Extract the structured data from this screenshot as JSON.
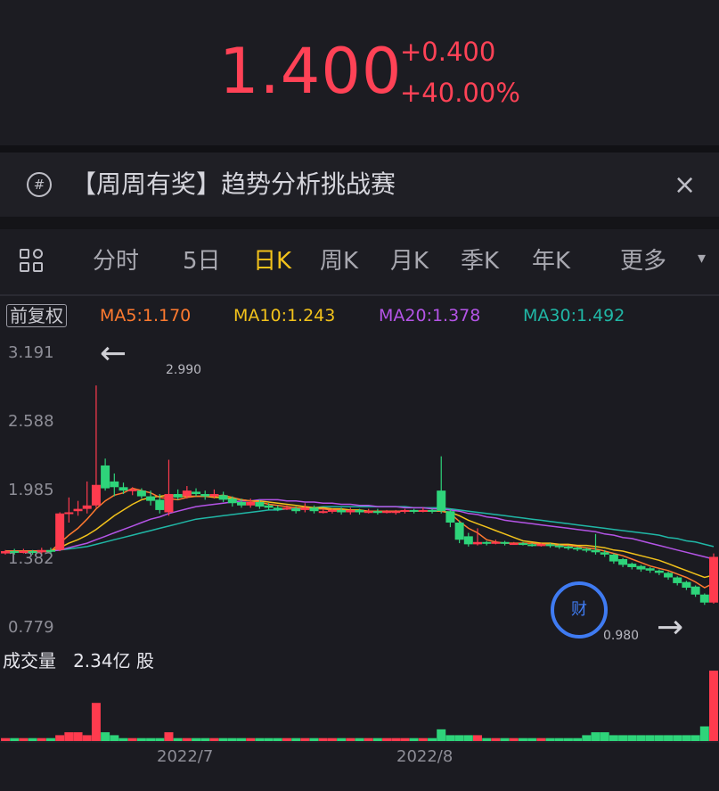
{
  "quote": {
    "price": "1.400",
    "change": "+0.400",
    "change_pct": "+40.00%",
    "color": "#ff4256"
  },
  "banner": {
    "icon": "hash-circle-icon",
    "text": "【周周有奖】趋势分析挑战赛",
    "close": "×"
  },
  "tabs": {
    "items": [
      "分时",
      "5日",
      "日K",
      "周K",
      "月K",
      "季K",
      "年K",
      "更多"
    ],
    "active": "日K",
    "active_color": "#f2c21b",
    "more_arrow": "▾"
  },
  "indicators": {
    "adjust": "前复权",
    "ma5": "MA5:1.170",
    "ma10": "MA10:1.243",
    "ma20": "MA20:1.378",
    "ma30": "MA30:1.492",
    "colors": {
      "ma5": "#ff7a2f",
      "ma10": "#f2c21b",
      "ma20": "#b454e6",
      "ma30": "#20b7a6"
    }
  },
  "chart": {
    "y_ticks": [
      "3.191",
      "2.588",
      "1.985",
      "1.382",
      "0.779"
    ],
    "high_label": "2.990",
    "low_label": "0.980",
    "badge": "财",
    "volume_title": "成交量",
    "volume_value": "2.34亿 股",
    "x_ticks": [
      "2022/7",
      "2022/8"
    ],
    "arrow_left": "←",
    "arrow_right": "→"
  },
  "chart_data": {
    "type": "candlestick",
    "ylim": [
      0.779,
      3.191
    ],
    "up_color": "#ff3b4e",
    "down_color": "#2ed47a",
    "candles": [
      [
        1.43,
        1.45,
        1.42,
        1.46
      ],
      [
        1.45,
        1.44,
        1.42,
        1.47
      ],
      [
        1.44,
        1.45,
        1.43,
        1.47
      ],
      [
        1.45,
        1.44,
        1.42,
        1.46
      ],
      [
        1.44,
        1.46,
        1.43,
        1.48
      ],
      [
        1.46,
        1.45,
        1.43,
        1.48
      ],
      [
        1.46,
        1.78,
        1.45,
        1.79
      ],
      [
        1.79,
        1.79,
        1.7,
        1.92
      ],
      [
        1.8,
        1.82,
        1.76,
        1.89
      ],
      [
        1.82,
        1.85,
        1.78,
        2.06
      ],
      [
        1.85,
        2.03,
        1.83,
        2.9
      ],
      [
        2.2,
        2.0,
        1.98,
        2.26
      ],
      [
        2.06,
        2.01,
        1.93,
        2.13
      ],
      [
        2.01,
        1.98,
        1.95,
        2.05
      ],
      [
        1.99,
        1.99,
        1.94,
        2.01
      ],
      [
        1.98,
        1.93,
        1.91,
        2.0
      ],
      [
        1.93,
        1.89,
        1.85,
        1.98
      ],
      [
        1.9,
        1.81,
        1.78,
        1.95
      ],
      [
        1.79,
        1.95,
        1.76,
        2.25
      ],
      [
        1.95,
        1.92,
        1.9,
        1.99
      ],
      [
        1.93,
        1.98,
        1.91,
        2.02
      ],
      [
        1.97,
        1.95,
        1.93,
        2.0
      ],
      [
        1.95,
        1.93,
        1.9,
        1.98
      ],
      [
        1.93,
        1.95,
        1.91,
        1.99
      ],
      [
        1.94,
        1.9,
        1.88,
        1.97
      ],
      [
        1.91,
        1.87,
        1.84,
        1.93
      ],
      [
        1.88,
        1.85,
        1.83,
        1.91
      ],
      [
        1.85,
        1.88,
        1.83,
        1.91
      ],
      [
        1.88,
        1.84,
        1.82,
        1.9
      ],
      [
        1.85,
        1.83,
        1.81,
        1.87
      ],
      [
        1.83,
        1.82,
        1.8,
        1.85
      ],
      [
        1.83,
        1.83,
        1.81,
        1.85
      ],
      [
        1.82,
        1.8,
        1.78,
        1.84
      ],
      [
        1.81,
        1.83,
        1.79,
        1.87
      ],
      [
        1.83,
        1.8,
        1.78,
        1.85
      ],
      [
        1.8,
        1.8,
        1.78,
        1.82
      ],
      [
        1.8,
        1.81,
        1.78,
        1.82
      ],
      [
        1.81,
        1.79,
        1.77,
        1.83
      ],
      [
        1.79,
        1.81,
        1.77,
        1.83
      ],
      [
        1.81,
        1.79,
        1.77,
        1.82
      ],
      [
        1.79,
        1.8,
        1.78,
        1.82
      ],
      [
        1.8,
        1.79,
        1.77,
        1.82
      ],
      [
        1.79,
        1.8,
        1.78,
        1.81
      ],
      [
        1.8,
        1.8,
        1.77,
        1.81
      ],
      [
        1.8,
        1.81,
        1.78,
        1.82
      ],
      [
        1.81,
        1.8,
        1.78,
        1.82
      ],
      [
        1.81,
        1.81,
        1.79,
        1.83
      ],
      [
        1.81,
        1.8,
        1.78,
        1.82
      ],
      [
        1.98,
        1.8,
        1.78,
        2.28
      ],
      [
        1.8,
        1.7,
        1.66,
        1.82
      ],
      [
        1.7,
        1.55,
        1.52,
        1.72
      ],
      [
        1.58,
        1.51,
        1.49,
        1.61
      ],
      [
        1.51,
        1.53,
        1.5,
        1.65
      ],
      [
        1.53,
        1.52,
        1.5,
        1.54
      ],
      [
        1.52,
        1.53,
        1.51,
        1.55
      ],
      [
        1.53,
        1.52,
        1.5,
        1.54
      ],
      [
        1.52,
        1.52,
        1.51,
        1.53
      ],
      [
        1.52,
        1.51,
        1.5,
        1.53
      ],
      [
        1.51,
        1.5,
        1.49,
        1.52
      ],
      [
        1.5,
        1.51,
        1.49,
        1.52
      ],
      [
        1.51,
        1.5,
        1.48,
        1.52
      ],
      [
        1.5,
        1.49,
        1.47,
        1.51
      ],
      [
        1.49,
        1.48,
        1.46,
        1.5
      ],
      [
        1.48,
        1.47,
        1.45,
        1.49
      ],
      [
        1.47,
        1.46,
        1.44,
        1.48
      ],
      [
        1.46,
        1.44,
        1.42,
        1.6
      ],
      [
        1.44,
        1.42,
        1.4,
        1.46
      ],
      [
        1.42,
        1.36,
        1.34,
        1.43
      ],
      [
        1.38,
        1.33,
        1.31,
        1.39
      ],
      [
        1.34,
        1.31,
        1.29,
        1.35
      ],
      [
        1.32,
        1.29,
        1.27,
        1.33
      ],
      [
        1.3,
        1.28,
        1.26,
        1.31
      ],
      [
        1.28,
        1.26,
        1.24,
        1.29
      ],
      [
        1.26,
        1.22,
        1.2,
        1.27
      ],
      [
        1.22,
        1.17,
        1.15,
        1.23
      ],
      [
        1.18,
        1.13,
        1.11,
        1.19
      ],
      [
        1.14,
        1.07,
        1.05,
        1.15
      ],
      [
        1.07,
        1.0,
        0.98,
        1.08
      ],
      [
        1.0,
        1.4,
        0.99,
        1.43
      ]
    ],
    "ma5": [
      1.45,
      1.45,
      1.45,
      1.45,
      1.45,
      1.45,
      1.52,
      1.59,
      1.65,
      1.73,
      1.82,
      1.89,
      1.94,
      1.96,
      2.0,
      1.98,
      1.96,
      1.92,
      1.91,
      1.9,
      1.92,
      1.93,
      1.93,
      1.93,
      1.94,
      1.92,
      1.9,
      1.89,
      1.88,
      1.86,
      1.85,
      1.84,
      1.83,
      1.83,
      1.82,
      1.82,
      1.81,
      1.81,
      1.8,
      1.8,
      1.8,
      1.8,
      1.8,
      1.8,
      1.8,
      1.8,
      1.8,
      1.8,
      1.8,
      1.78,
      1.71,
      1.65,
      1.61,
      1.55,
      1.53,
      1.52,
      1.52,
      1.52,
      1.52,
      1.51,
      1.51,
      1.5,
      1.5,
      1.49,
      1.48,
      1.47,
      1.45,
      1.43,
      1.41,
      1.38,
      1.35,
      1.32,
      1.3,
      1.28,
      1.25,
      1.22,
      1.18,
      1.13,
      1.17
    ],
    "ma10": [
      1.45,
      1.45,
      1.45,
      1.45,
      1.45,
      1.45,
      1.48,
      1.52,
      1.55,
      1.59,
      1.64,
      1.7,
      1.76,
      1.81,
      1.86,
      1.9,
      1.92,
      1.93,
      1.94,
      1.93,
      1.93,
      1.93,
      1.93,
      1.92,
      1.92,
      1.91,
      1.9,
      1.89,
      1.89,
      1.88,
      1.87,
      1.86,
      1.85,
      1.84,
      1.83,
      1.83,
      1.82,
      1.82,
      1.81,
      1.81,
      1.8,
      1.8,
      1.8,
      1.8,
      1.8,
      1.8,
      1.8,
      1.8,
      1.8,
      1.79,
      1.76,
      1.72,
      1.69,
      1.66,
      1.63,
      1.6,
      1.57,
      1.54,
      1.53,
      1.52,
      1.52,
      1.51,
      1.51,
      1.5,
      1.5,
      1.49,
      1.48,
      1.46,
      1.45,
      1.43,
      1.41,
      1.39,
      1.37,
      1.34,
      1.31,
      1.28,
      1.25,
      1.22,
      1.24
    ],
    "ma20": [
      1.45,
      1.45,
      1.45,
      1.45,
      1.45,
      1.45,
      1.46,
      1.48,
      1.5,
      1.52,
      1.55,
      1.58,
      1.61,
      1.64,
      1.67,
      1.7,
      1.73,
      1.75,
      1.78,
      1.8,
      1.82,
      1.84,
      1.85,
      1.86,
      1.87,
      1.88,
      1.89,
      1.89,
      1.9,
      1.9,
      1.9,
      1.89,
      1.89,
      1.88,
      1.88,
      1.87,
      1.87,
      1.86,
      1.86,
      1.85,
      1.85,
      1.84,
      1.84,
      1.84,
      1.83,
      1.83,
      1.83,
      1.82,
      1.82,
      1.81,
      1.8,
      1.78,
      1.77,
      1.75,
      1.74,
      1.72,
      1.71,
      1.7,
      1.69,
      1.68,
      1.67,
      1.66,
      1.65,
      1.64,
      1.63,
      1.62,
      1.6,
      1.59,
      1.57,
      1.56,
      1.54,
      1.52,
      1.5,
      1.48,
      1.46,
      1.44,
      1.42,
      1.4,
      1.38
    ],
    "ma30": [
      1.45,
      1.45,
      1.45,
      1.45,
      1.45,
      1.45,
      1.46,
      1.47,
      1.48,
      1.49,
      1.51,
      1.53,
      1.55,
      1.57,
      1.59,
      1.61,
      1.63,
      1.65,
      1.67,
      1.69,
      1.71,
      1.73,
      1.74,
      1.75,
      1.76,
      1.77,
      1.78,
      1.79,
      1.8,
      1.81,
      1.81,
      1.82,
      1.82,
      1.83,
      1.83,
      1.84,
      1.84,
      1.84,
      1.84,
      1.84,
      1.84,
      1.84,
      1.84,
      1.84,
      1.84,
      1.83,
      1.83,
      1.83,
      1.83,
      1.82,
      1.81,
      1.8,
      1.79,
      1.78,
      1.77,
      1.76,
      1.75,
      1.74,
      1.73,
      1.72,
      1.71,
      1.7,
      1.69,
      1.68,
      1.67,
      1.66,
      1.65,
      1.64,
      1.63,
      1.62,
      1.61,
      1.6,
      1.59,
      1.57,
      1.56,
      1.54,
      1.53,
      1.51,
      1.49
    ],
    "volume": [
      1,
      1,
      1,
      1,
      1,
      1,
      2,
      3,
      3,
      2,
      13,
      3,
      2,
      1,
      1,
      1,
      1,
      1,
      3,
      1,
      1,
      1,
      1,
      1,
      1,
      1,
      1,
      1,
      1,
      1,
      1,
      1,
      1,
      1,
      1,
      1,
      1,
      1,
      1,
      1,
      1,
      1,
      1,
      1,
      1,
      1,
      1,
      1,
      4,
      2,
      2,
      2,
      2,
      1,
      1,
      1,
      1,
      1,
      1,
      1,
      1,
      1,
      1,
      1,
      2,
      3,
      3,
      2,
      2,
      2,
      2,
      2,
      2,
      2,
      2,
      2,
      2,
      5,
      24
    ]
  }
}
